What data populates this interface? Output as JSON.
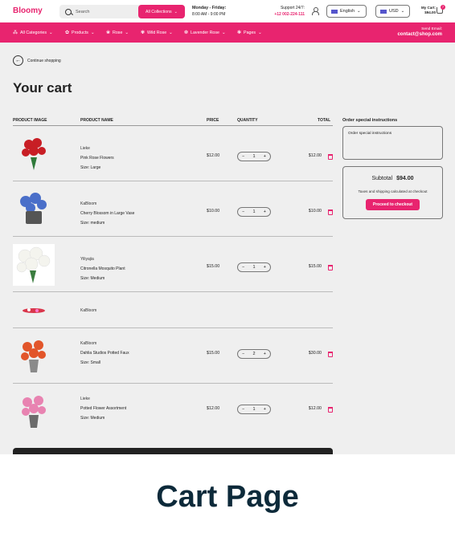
{
  "header": {
    "logo": "Bloomy",
    "search_placeholder": "Search",
    "collections_label": "All Collections",
    "hours_title": "Monday - Friday:",
    "hours_time": "8:00 AM - 9:00 PM",
    "support_title": "Support 24/7:",
    "support_phone": "+12 002-224-111",
    "language": "English",
    "currency": "USD",
    "mycart_label": "My Cart:",
    "mycart_amount": "$94.00",
    "cart_count": "7"
  },
  "nav": {
    "items": [
      {
        "label": "All Categories",
        "icon": "grid-icon"
      },
      {
        "label": "Products",
        "icon": "flower-icon"
      },
      {
        "label": "Rose",
        "icon": "rose-icon"
      },
      {
        "label": "Wild Rose",
        "icon": "wild-rose-icon"
      },
      {
        "label": "Lavender Rose",
        "icon": "lavender-icon"
      },
      {
        "label": "Pages",
        "icon": "pages-icon"
      }
    ],
    "send_email_label": "Send Email:",
    "send_email": "contact@shop.com"
  },
  "cart": {
    "continue_label": "Continue shopping",
    "title": "Your cart",
    "headers": {
      "image": "PRODUCT IMAGE",
      "name": "PRODUCT NAME",
      "price": "PRICE",
      "quantity": "QUANTITY",
      "total": "TOTAL"
    },
    "size_label": "Size:",
    "items": [
      {
        "brand": "Lieke",
        "name": "Pink Rose Flowers",
        "size": "Large",
        "price": "$12.00",
        "qty": "1",
        "total": "$12.00"
      },
      {
        "brand": "KaBloom",
        "name": "Cherry Blossom in Large Vase",
        "size": "medium",
        "price": "$10.00",
        "qty": "1",
        "total": "$10.00"
      },
      {
        "brand": "Yiliyajia",
        "name": "Citronella Mosquito Plant",
        "size": "Medium",
        "price": "$15.00",
        "qty": "1",
        "total": "$15.00"
      },
      {
        "brand": "KaBloom"
      },
      {
        "brand": "KaBloom",
        "name": "Dahlia Studios Potted Faux",
        "size": "Small",
        "price": "$15.00",
        "qty": "2",
        "total": "$30.00"
      },
      {
        "brand": "Lieke",
        "name": "Potted Flower Assortment",
        "size": "Medium",
        "price": "$12.00",
        "qty": "1",
        "total": "$12.00"
      }
    ]
  },
  "sidebar": {
    "instructions_title": "Order special instructions",
    "instructions_placeholder": "Order special instructions",
    "subtotal_label": "Subtotal",
    "subtotal_value": "$94.00",
    "tax_note": "Taxes and shipping calculated at checkout",
    "checkout_label": "Proceed to checkout"
  },
  "caption": "Cart Page",
  "colors": {
    "accent": "#e8246f",
    "background": "#efefef",
    "caption": "#0d2a3a"
  }
}
